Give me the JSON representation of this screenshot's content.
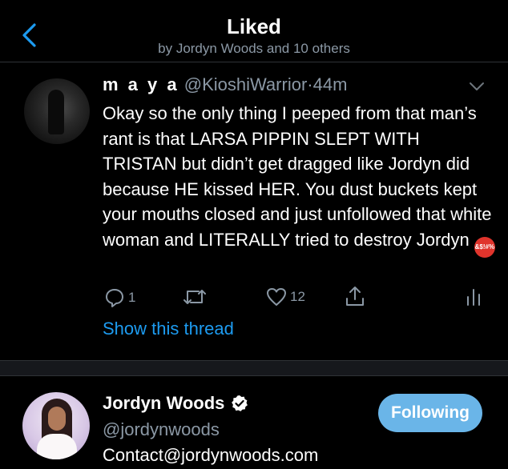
{
  "header": {
    "title": "Liked",
    "subtitle": "by Jordyn Woods and 10 others",
    "back_icon": "chevron-left-icon"
  },
  "tweet": {
    "display_name": "m a y a",
    "handle": "@KioshiWarrior",
    "separator": "·",
    "time": "44m",
    "text": "Okay so the only thing I peeped from that man’s rant is that LARSA PIPPIN SLEPT WITH TRISTAN but didn’t get dragged like Jordyn did because HE kissed HER. You dust buckets kept your mouths closed and just unfollowed that white woman and LITERALLY tried to destroy Jordyn",
    "emoji_text": "&$!#%",
    "emoji_icon": "angry-face-with-symbols-icon",
    "actions": {
      "reply_count": "1",
      "retweet_count": "",
      "like_count": "12"
    },
    "show_thread": "Show this thread"
  },
  "user": {
    "name": "Jordyn Woods",
    "handle": "@jordynwoods",
    "bio": "Contact@jordynwoods.com",
    "follow_label": "Following",
    "verified_icon": "verified-badge-icon"
  },
  "colors": {
    "background": "#000000",
    "accent": "#1d9bf0",
    "secondary_text": "#8b98a5",
    "following_button": "#6ab5e8",
    "divider": "#16181c"
  }
}
